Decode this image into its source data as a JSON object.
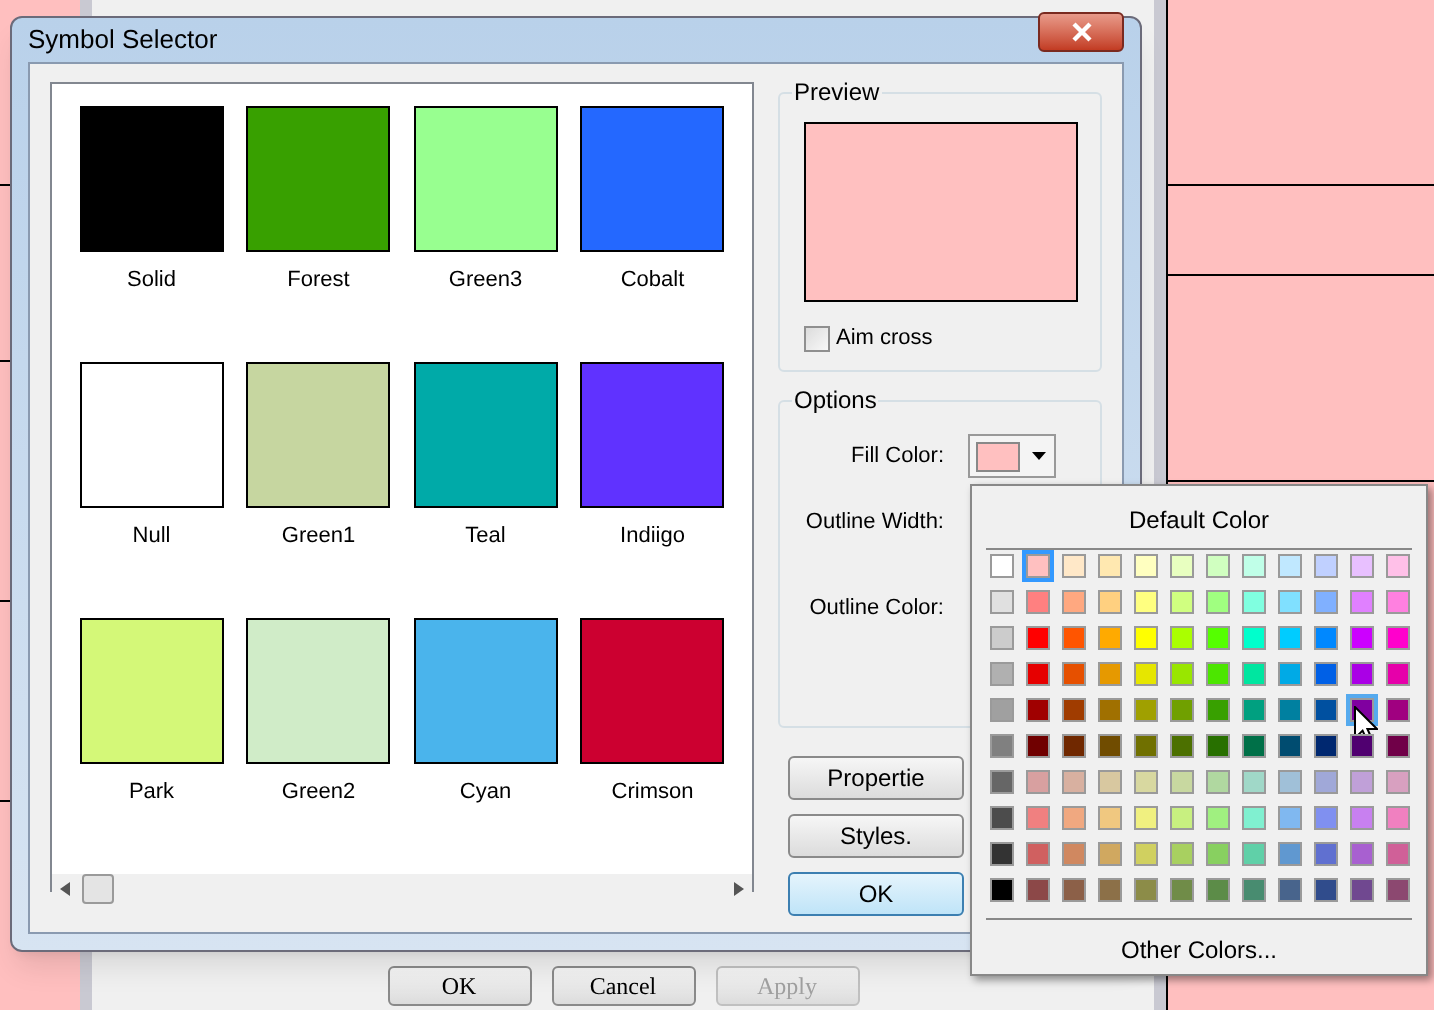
{
  "window": {
    "title": "Symbol Selector"
  },
  "symbols": [
    {
      "name": "Solid",
      "color": "#000000",
      "selected": false
    },
    {
      "name": "Forest",
      "color": "#38a000",
      "selected": false
    },
    {
      "name": "Green3",
      "color": "#98ff90",
      "selected": false
    },
    {
      "name": "Cobalt",
      "color": "#2468ff",
      "selected": false
    },
    {
      "name": "Null",
      "color": "#ffffff",
      "selected": false
    },
    {
      "name": "Green1",
      "color": "#c6d6a0",
      "selected": false
    },
    {
      "name": "Teal",
      "color": "#00aaa8",
      "selected": false
    },
    {
      "name": "Indiigo",
      "color": "#6032ff",
      "selected": false
    },
    {
      "name": "Park",
      "color": "#d4f878",
      "selected": false
    },
    {
      "name": "Green2",
      "color": "#d0ecc8",
      "selected": false
    },
    {
      "name": "Cyan",
      "color": "#4ab4ec",
      "selected": false
    },
    {
      "name": "Crimson",
      "color": "#cc0030",
      "selected": false
    }
  ],
  "preview": {
    "label": "Preview",
    "color": "#ffc0c0",
    "aim_cross": {
      "label": "Aim cross",
      "checked": false
    }
  },
  "options": {
    "label": "Options",
    "fill_color": {
      "label": "Fill Color:",
      "color": "#ffc0c0"
    },
    "outline_width": {
      "label": "Outline Width:"
    },
    "outline_color": {
      "label": "Outline Color:"
    }
  },
  "buttons": [
    {
      "label": "Propertie",
      "default": false
    },
    {
      "label": "Styles.",
      "default": false
    },
    {
      "label": "OK",
      "default": true
    }
  ],
  "color_popup": {
    "title": "Default Color",
    "footer": "Other Colors...",
    "rows": [
      [
        {
          "color": "#ffffff",
          "selected": false,
          "hovered": false
        },
        {
          "color": "#ffc0c0",
          "selected": true,
          "hovered": false
        },
        {
          "color": "#ffe8c8",
          "selected": false,
          "hovered": false
        },
        {
          "color": "#ffe8b0",
          "selected": false,
          "hovered": false
        },
        {
          "color": "#ffffc0",
          "selected": false,
          "hovered": false
        },
        {
          "color": "#e8ffc0",
          "selected": false,
          "hovered": false
        },
        {
          "color": "#d0ffc0",
          "selected": false,
          "hovered": false
        },
        {
          "color": "#c0ffe8",
          "selected": false,
          "hovered": false
        },
        {
          "color": "#c0e8ff",
          "selected": false,
          "hovered": false
        },
        {
          "color": "#c0d0ff",
          "selected": false,
          "hovered": false
        },
        {
          "color": "#e8c0ff",
          "selected": false,
          "hovered": false
        },
        {
          "color": "#ffc0e8",
          "selected": false,
          "hovered": false
        }
      ],
      [
        {
          "color": "#e0e0e0",
          "selected": false,
          "hovered": false
        },
        {
          "color": "#ff8080",
          "selected": false,
          "hovered": false
        },
        {
          "color": "#ffa880",
          "selected": false,
          "hovered": false
        },
        {
          "color": "#ffd080",
          "selected": false,
          "hovered": false
        },
        {
          "color": "#ffff80",
          "selected": false,
          "hovered": false
        },
        {
          "color": "#d0ff80",
          "selected": false,
          "hovered": false
        },
        {
          "color": "#a0ff80",
          "selected": false,
          "hovered": false
        },
        {
          "color": "#80ffe0",
          "selected": false,
          "hovered": false
        },
        {
          "color": "#80e0ff",
          "selected": false,
          "hovered": false
        },
        {
          "color": "#80b0ff",
          "selected": false,
          "hovered": false
        },
        {
          "color": "#e080ff",
          "selected": false,
          "hovered": false
        },
        {
          "color": "#ff80e0",
          "selected": false,
          "hovered": false
        }
      ],
      [
        {
          "color": "#cccccc",
          "selected": false,
          "hovered": false
        },
        {
          "color": "#ff0000",
          "selected": false,
          "hovered": false
        },
        {
          "color": "#ff5500",
          "selected": false,
          "hovered": false
        },
        {
          "color": "#ffaa00",
          "selected": false,
          "hovered": false
        },
        {
          "color": "#ffff00",
          "selected": false,
          "hovered": false
        },
        {
          "color": "#aaff00",
          "selected": false,
          "hovered": false
        },
        {
          "color": "#55ff00",
          "selected": false,
          "hovered": false
        },
        {
          "color": "#00ffcc",
          "selected": false,
          "hovered": false
        },
        {
          "color": "#00ccff",
          "selected": false,
          "hovered": false
        },
        {
          "color": "#0088ff",
          "selected": false,
          "hovered": false
        },
        {
          "color": "#cc00ff",
          "selected": false,
          "hovered": false
        },
        {
          "color": "#ff00cc",
          "selected": false,
          "hovered": false
        }
      ],
      [
        {
          "color": "#b0b0b0",
          "selected": false,
          "hovered": false
        },
        {
          "color": "#e60000",
          "selected": false,
          "hovered": false
        },
        {
          "color": "#e65000",
          "selected": false,
          "hovered": false
        },
        {
          "color": "#e69900",
          "selected": false,
          "hovered": false
        },
        {
          "color": "#e6e600",
          "selected": false,
          "hovered": false
        },
        {
          "color": "#99e600",
          "selected": false,
          "hovered": false
        },
        {
          "color": "#4ce600",
          "selected": false,
          "hovered": false
        },
        {
          "color": "#00e6a0",
          "selected": false,
          "hovered": false
        },
        {
          "color": "#00aae6",
          "selected": false,
          "hovered": false
        },
        {
          "color": "#0060e6",
          "selected": false,
          "hovered": false
        },
        {
          "color": "#aa00e6",
          "selected": false,
          "hovered": false
        },
        {
          "color": "#e600aa",
          "selected": false,
          "hovered": false
        }
      ],
      [
        {
          "color": "#a0a0a0",
          "selected": false,
          "hovered": false
        },
        {
          "color": "#a00000",
          "selected": false,
          "hovered": false
        },
        {
          "color": "#a03c00",
          "selected": false,
          "hovered": false
        },
        {
          "color": "#a07000",
          "selected": false,
          "hovered": false
        },
        {
          "color": "#a0a000",
          "selected": false,
          "hovered": false
        },
        {
          "color": "#70a000",
          "selected": false,
          "hovered": false
        },
        {
          "color": "#38a000",
          "selected": false,
          "hovered": false
        },
        {
          "color": "#00a080",
          "selected": false,
          "hovered": false
        },
        {
          "color": "#0080a0",
          "selected": false,
          "hovered": false
        },
        {
          "color": "#0050a0",
          "selected": false,
          "hovered": false
        },
        {
          "color": "#8000a0",
          "selected": false,
          "hovered": true
        },
        {
          "color": "#a00080",
          "selected": false,
          "hovered": false
        }
      ],
      [
        {
          "color": "#808080",
          "selected": false,
          "hovered": false
        },
        {
          "color": "#700000",
          "selected": false,
          "hovered": false
        },
        {
          "color": "#702800",
          "selected": false,
          "hovered": false
        },
        {
          "color": "#704c00",
          "selected": false,
          "hovered": false
        },
        {
          "color": "#707000",
          "selected": false,
          "hovered": false
        },
        {
          "color": "#4c7000",
          "selected": false,
          "hovered": false
        },
        {
          "color": "#287000",
          "selected": false,
          "hovered": false
        },
        {
          "color": "#007048",
          "selected": false,
          "hovered": false
        },
        {
          "color": "#004c70",
          "selected": false,
          "hovered": false
        },
        {
          "color": "#002870",
          "selected": false,
          "hovered": false
        },
        {
          "color": "#500070",
          "selected": false,
          "hovered": false
        },
        {
          "color": "#700048",
          "selected": false,
          "hovered": false
        }
      ],
      [
        {
          "color": "#666666",
          "selected": false,
          "hovered": false
        },
        {
          "color": "#d8a0a0",
          "selected": false,
          "hovered": false
        },
        {
          "color": "#d8b0a0",
          "selected": false,
          "hovered": false
        },
        {
          "color": "#d8c8a0",
          "selected": false,
          "hovered": false
        },
        {
          "color": "#d8d8a0",
          "selected": false,
          "hovered": false
        },
        {
          "color": "#c8d8a0",
          "selected": false,
          "hovered": false
        },
        {
          "color": "#b0d8a0",
          "selected": false,
          "hovered": false
        },
        {
          "color": "#a0d8c8",
          "selected": false,
          "hovered": false
        },
        {
          "color": "#a0c0d8",
          "selected": false,
          "hovered": false
        },
        {
          "color": "#a0a8d8",
          "selected": false,
          "hovered": false
        },
        {
          "color": "#c0a0d8",
          "selected": false,
          "hovered": false
        },
        {
          "color": "#d8a0c0",
          "selected": false,
          "hovered": false
        }
      ],
      [
        {
          "color": "#4c4c4c",
          "selected": false,
          "hovered": false
        },
        {
          "color": "#f08080",
          "selected": false,
          "hovered": false
        },
        {
          "color": "#f0a880",
          "selected": false,
          "hovered": false
        },
        {
          "color": "#f0c880",
          "selected": false,
          "hovered": false
        },
        {
          "color": "#f0f080",
          "selected": false,
          "hovered": false
        },
        {
          "color": "#c8f080",
          "selected": false,
          "hovered": false
        },
        {
          "color": "#a0f080",
          "selected": false,
          "hovered": false
        },
        {
          "color": "#80f0d0",
          "selected": false,
          "hovered": false
        },
        {
          "color": "#80b8f0",
          "selected": false,
          "hovered": false
        },
        {
          "color": "#8090f0",
          "selected": false,
          "hovered": false
        },
        {
          "color": "#c880f0",
          "selected": false,
          "hovered": false
        },
        {
          "color": "#f080c0",
          "selected": false,
          "hovered": false
        }
      ],
      [
        {
          "color": "#333333",
          "selected": false,
          "hovered": false
        },
        {
          "color": "#d06060",
          "selected": false,
          "hovered": false
        },
        {
          "color": "#d08860",
          "selected": false,
          "hovered": false
        },
        {
          "color": "#d0a860",
          "selected": false,
          "hovered": false
        },
        {
          "color": "#d0d060",
          "selected": false,
          "hovered": false
        },
        {
          "color": "#a8d060",
          "selected": false,
          "hovered": false
        },
        {
          "color": "#88d060",
          "selected": false,
          "hovered": false
        },
        {
          "color": "#60d0a8",
          "selected": false,
          "hovered": false
        },
        {
          "color": "#6098d0",
          "selected": false,
          "hovered": false
        },
        {
          "color": "#6070d0",
          "selected": false,
          "hovered": false
        },
        {
          "color": "#a860d0",
          "selected": false,
          "hovered": false
        },
        {
          "color": "#d06098",
          "selected": false,
          "hovered": false
        }
      ],
      [
        {
          "color": "#000000",
          "selected": false,
          "hovered": false
        },
        {
          "color": "#8c4848",
          "selected": false,
          "hovered": false
        },
        {
          "color": "#8c6048",
          "selected": false,
          "hovered": false
        },
        {
          "color": "#8c7048",
          "selected": false,
          "hovered": false
        },
        {
          "color": "#8c8c48",
          "selected": false,
          "hovered": false
        },
        {
          "color": "#708c48",
          "selected": false,
          "hovered": false
        },
        {
          "color": "#5c8c48",
          "selected": false,
          "hovered": false
        },
        {
          "color": "#488c70",
          "selected": false,
          "hovered": false
        },
        {
          "color": "#48648c",
          "selected": false,
          "hovered": false
        },
        {
          "color": "#304c8c",
          "selected": false,
          "hovered": false
        },
        {
          "color": "#704890",
          "selected": false,
          "hovered": false
        },
        {
          "color": "#8c4870",
          "selected": false,
          "hovered": false
        }
      ]
    ]
  },
  "background_buttons": [
    {
      "label": "OK",
      "disabled": false
    },
    {
      "label": "Cancel",
      "disabled": false
    },
    {
      "label": "Apply",
      "disabled": true
    }
  ]
}
